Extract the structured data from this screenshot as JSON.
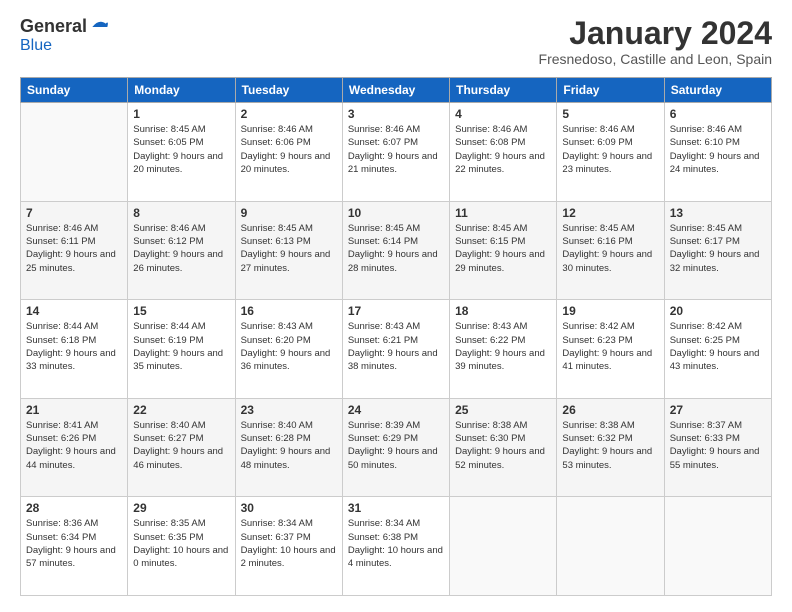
{
  "logo": {
    "general": "General",
    "blue": "Blue"
  },
  "title": "January 2024",
  "subtitle": "Fresnedoso, Castille and Leon, Spain",
  "weekdays": [
    "Sunday",
    "Monday",
    "Tuesday",
    "Wednesday",
    "Thursday",
    "Friday",
    "Saturday"
  ],
  "weeks": [
    [
      {
        "day": "",
        "sunrise": "",
        "sunset": "",
        "daylight": ""
      },
      {
        "day": "1",
        "sunrise": "Sunrise: 8:45 AM",
        "sunset": "Sunset: 6:05 PM",
        "daylight": "Daylight: 9 hours and 20 minutes."
      },
      {
        "day": "2",
        "sunrise": "Sunrise: 8:46 AM",
        "sunset": "Sunset: 6:06 PM",
        "daylight": "Daylight: 9 hours and 20 minutes."
      },
      {
        "day": "3",
        "sunrise": "Sunrise: 8:46 AM",
        "sunset": "Sunset: 6:07 PM",
        "daylight": "Daylight: 9 hours and 21 minutes."
      },
      {
        "day": "4",
        "sunrise": "Sunrise: 8:46 AM",
        "sunset": "Sunset: 6:08 PM",
        "daylight": "Daylight: 9 hours and 22 minutes."
      },
      {
        "day": "5",
        "sunrise": "Sunrise: 8:46 AM",
        "sunset": "Sunset: 6:09 PM",
        "daylight": "Daylight: 9 hours and 23 minutes."
      },
      {
        "day": "6",
        "sunrise": "Sunrise: 8:46 AM",
        "sunset": "Sunset: 6:10 PM",
        "daylight": "Daylight: 9 hours and 24 minutes."
      }
    ],
    [
      {
        "day": "7",
        "sunrise": "Sunrise: 8:46 AM",
        "sunset": "Sunset: 6:11 PM",
        "daylight": "Daylight: 9 hours and 25 minutes."
      },
      {
        "day": "8",
        "sunrise": "Sunrise: 8:46 AM",
        "sunset": "Sunset: 6:12 PM",
        "daylight": "Daylight: 9 hours and 26 minutes."
      },
      {
        "day": "9",
        "sunrise": "Sunrise: 8:45 AM",
        "sunset": "Sunset: 6:13 PM",
        "daylight": "Daylight: 9 hours and 27 minutes."
      },
      {
        "day": "10",
        "sunrise": "Sunrise: 8:45 AM",
        "sunset": "Sunset: 6:14 PM",
        "daylight": "Daylight: 9 hours and 28 minutes."
      },
      {
        "day": "11",
        "sunrise": "Sunrise: 8:45 AM",
        "sunset": "Sunset: 6:15 PM",
        "daylight": "Daylight: 9 hours and 29 minutes."
      },
      {
        "day": "12",
        "sunrise": "Sunrise: 8:45 AM",
        "sunset": "Sunset: 6:16 PM",
        "daylight": "Daylight: 9 hours and 30 minutes."
      },
      {
        "day": "13",
        "sunrise": "Sunrise: 8:45 AM",
        "sunset": "Sunset: 6:17 PM",
        "daylight": "Daylight: 9 hours and 32 minutes."
      }
    ],
    [
      {
        "day": "14",
        "sunrise": "Sunrise: 8:44 AM",
        "sunset": "Sunset: 6:18 PM",
        "daylight": "Daylight: 9 hours and 33 minutes."
      },
      {
        "day": "15",
        "sunrise": "Sunrise: 8:44 AM",
        "sunset": "Sunset: 6:19 PM",
        "daylight": "Daylight: 9 hours and 35 minutes."
      },
      {
        "day": "16",
        "sunrise": "Sunrise: 8:43 AM",
        "sunset": "Sunset: 6:20 PM",
        "daylight": "Daylight: 9 hours and 36 minutes."
      },
      {
        "day": "17",
        "sunrise": "Sunrise: 8:43 AM",
        "sunset": "Sunset: 6:21 PM",
        "daylight": "Daylight: 9 hours and 38 minutes."
      },
      {
        "day": "18",
        "sunrise": "Sunrise: 8:43 AM",
        "sunset": "Sunset: 6:22 PM",
        "daylight": "Daylight: 9 hours and 39 minutes."
      },
      {
        "day": "19",
        "sunrise": "Sunrise: 8:42 AM",
        "sunset": "Sunset: 6:23 PM",
        "daylight": "Daylight: 9 hours and 41 minutes."
      },
      {
        "day": "20",
        "sunrise": "Sunrise: 8:42 AM",
        "sunset": "Sunset: 6:25 PM",
        "daylight": "Daylight: 9 hours and 43 minutes."
      }
    ],
    [
      {
        "day": "21",
        "sunrise": "Sunrise: 8:41 AM",
        "sunset": "Sunset: 6:26 PM",
        "daylight": "Daylight: 9 hours and 44 minutes."
      },
      {
        "day": "22",
        "sunrise": "Sunrise: 8:40 AM",
        "sunset": "Sunset: 6:27 PM",
        "daylight": "Daylight: 9 hours and 46 minutes."
      },
      {
        "day": "23",
        "sunrise": "Sunrise: 8:40 AM",
        "sunset": "Sunset: 6:28 PM",
        "daylight": "Daylight: 9 hours and 48 minutes."
      },
      {
        "day": "24",
        "sunrise": "Sunrise: 8:39 AM",
        "sunset": "Sunset: 6:29 PM",
        "daylight": "Daylight: 9 hours and 50 minutes."
      },
      {
        "day": "25",
        "sunrise": "Sunrise: 8:38 AM",
        "sunset": "Sunset: 6:30 PM",
        "daylight": "Daylight: 9 hours and 52 minutes."
      },
      {
        "day": "26",
        "sunrise": "Sunrise: 8:38 AM",
        "sunset": "Sunset: 6:32 PM",
        "daylight": "Daylight: 9 hours and 53 minutes."
      },
      {
        "day": "27",
        "sunrise": "Sunrise: 8:37 AM",
        "sunset": "Sunset: 6:33 PM",
        "daylight": "Daylight: 9 hours and 55 minutes."
      }
    ],
    [
      {
        "day": "28",
        "sunrise": "Sunrise: 8:36 AM",
        "sunset": "Sunset: 6:34 PM",
        "daylight": "Daylight: 9 hours and 57 minutes."
      },
      {
        "day": "29",
        "sunrise": "Sunrise: 8:35 AM",
        "sunset": "Sunset: 6:35 PM",
        "daylight": "Daylight: 10 hours and 0 minutes."
      },
      {
        "day": "30",
        "sunrise": "Sunrise: 8:34 AM",
        "sunset": "Sunset: 6:37 PM",
        "daylight": "Daylight: 10 hours and 2 minutes."
      },
      {
        "day": "31",
        "sunrise": "Sunrise: 8:34 AM",
        "sunset": "Sunset: 6:38 PM",
        "daylight": "Daylight: 10 hours and 4 minutes."
      },
      {
        "day": "",
        "sunrise": "",
        "sunset": "",
        "daylight": ""
      },
      {
        "day": "",
        "sunrise": "",
        "sunset": "",
        "daylight": ""
      },
      {
        "day": "",
        "sunrise": "",
        "sunset": "",
        "daylight": ""
      }
    ]
  ]
}
